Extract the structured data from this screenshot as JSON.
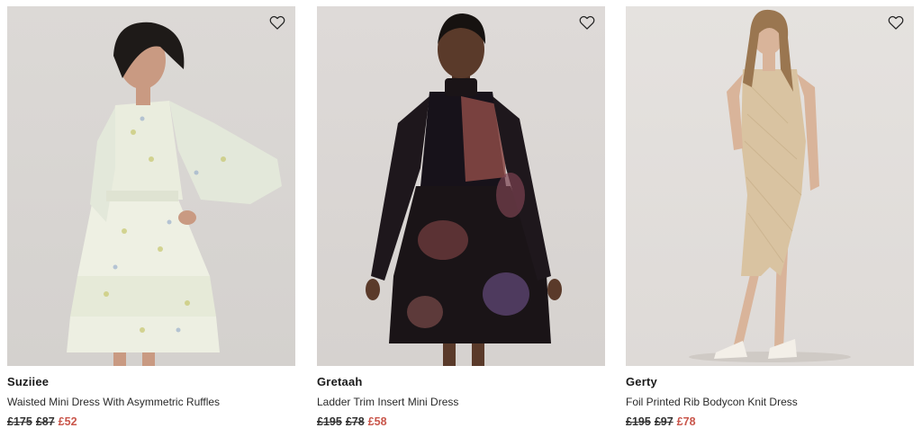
{
  "colors": {
    "sale": "#c9564b",
    "text": "#1a1a1a",
    "background": "#ffffff"
  },
  "products": [
    {
      "brand": "Suziiee",
      "description": "Waisted Mini Dress With Asymmetric Ruffles",
      "old_prices": [
        "£175",
        "£87"
      ],
      "sale_price": "£52",
      "wishlist_icon": "heart-outline-icon"
    },
    {
      "brand": "Gretaah",
      "description": "Ladder Trim Insert Mini Dress",
      "old_prices": [
        "£195",
        "£78"
      ],
      "sale_price": "£58",
      "wishlist_icon": "heart-outline-icon"
    },
    {
      "brand": "Gerty",
      "description": "Foil Printed Rib Bodycon Knit Dress",
      "old_prices": [
        "£195",
        "£97"
      ],
      "sale_price": "£78",
      "wishlist_icon": "heart-outline-icon"
    }
  ]
}
